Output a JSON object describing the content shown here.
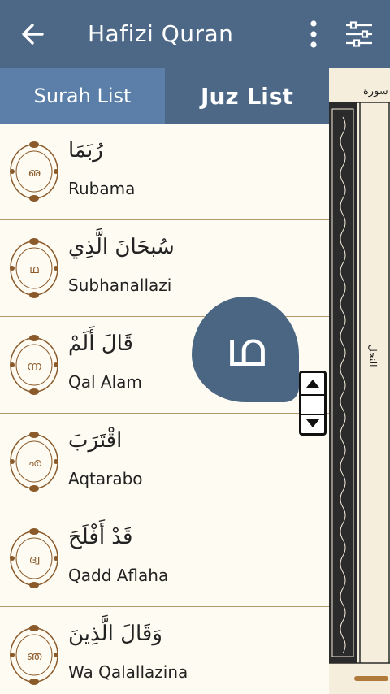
{
  "appbar": {
    "title": "Hafizi Quran"
  },
  "tabs": [
    {
      "label": "Surah List",
      "selected": false
    },
    {
      "label": "Juz List",
      "selected": true
    }
  ],
  "juz_list": [
    {
      "arabic": "رُبَمَا",
      "name": "Rubama",
      "glyph": "ഌ"
    },
    {
      "arabic": "سُبحَانَ الَّذِي",
      "name": "Subhanallazi",
      "glyph": "ഥ"
    },
    {
      "arabic": "قَالَ أَلَمْ",
      "name": "Qal Alam",
      "glyph": "ന്ന"
    },
    {
      "arabic": "اقْتَرَبَ",
      "name": "Aqtarabo",
      "glyph": "ഛ"
    },
    {
      "arabic": "قَدْ أَفْلَحَ",
      "name": "Qadd Aflaha",
      "glyph": "ദ്വ"
    },
    {
      "arabic": "وَقَالَ الَّذِينَ",
      "name": "Wa Qalallazina",
      "glyph": "ഞ"
    }
  ],
  "overlay_bubble": {
    "glyph": "ഥ"
  },
  "side_page": {
    "header_text": "سورة",
    "side_label": "النحل"
  },
  "colors": {
    "appbar": "#4d6886",
    "tab_unselected": "#5b7fa8",
    "list_bg": "#fdfbf2",
    "divider": "#b49a6a",
    "emblem": "#8b5a2b"
  }
}
